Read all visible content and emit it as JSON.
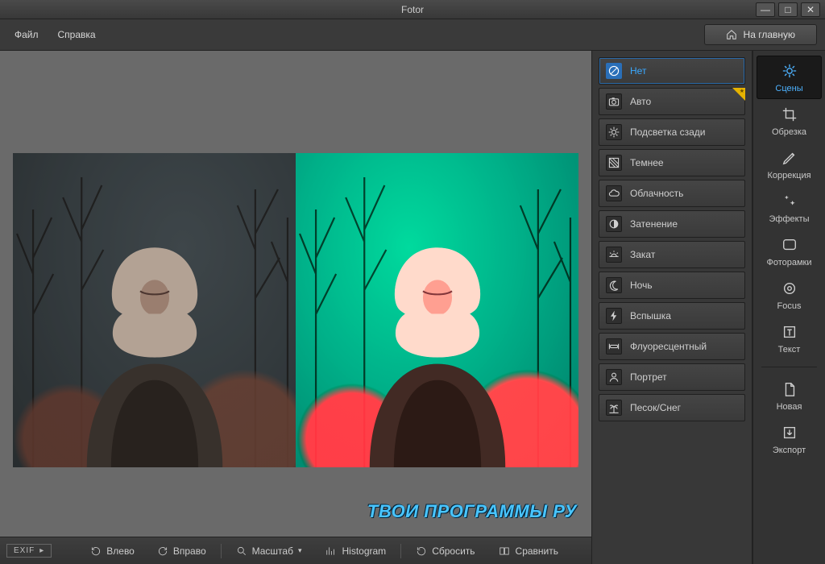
{
  "app": {
    "title": "Fotor"
  },
  "window_controls": {
    "min": "—",
    "max": "□",
    "close": "✕"
  },
  "menubar": {
    "file": "Файл",
    "help": "Справка"
  },
  "header": {
    "home": "На главную"
  },
  "presets": {
    "items": [
      {
        "id": "none",
        "label": "Нет",
        "icon": "prohibit",
        "active": true,
        "starred": false
      },
      {
        "id": "auto",
        "label": "Авто",
        "icon": "camera",
        "active": false,
        "starred": true
      },
      {
        "id": "backlit",
        "label": "Подсветка сзади",
        "icon": "sunback",
        "active": false,
        "starred": false
      },
      {
        "id": "darken",
        "label": "Темнее",
        "icon": "darken",
        "active": false,
        "starred": false
      },
      {
        "id": "cloudy",
        "label": "Облачность",
        "icon": "cloud",
        "active": false,
        "starred": false
      },
      {
        "id": "shade",
        "label": "Затенение",
        "icon": "shade",
        "active": false,
        "starred": false
      },
      {
        "id": "sunset",
        "label": "Закат",
        "icon": "sunset",
        "active": false,
        "starred": false
      },
      {
        "id": "night",
        "label": "Ночь",
        "icon": "moon",
        "active": false,
        "starred": false
      },
      {
        "id": "flash",
        "label": "Вспышка",
        "icon": "flash",
        "active": false,
        "starred": false
      },
      {
        "id": "fluorescent",
        "label": "Флуоресцентный",
        "icon": "fluor",
        "active": false,
        "starred": false
      },
      {
        "id": "portrait",
        "label": "Портрет",
        "icon": "portrait",
        "active": false,
        "starred": false
      },
      {
        "id": "sandsnow",
        "label": "Песок/Снег",
        "icon": "palm",
        "active": false,
        "starred": false
      }
    ]
  },
  "tools": {
    "items": [
      {
        "id": "scenes",
        "label": "Сцены",
        "icon": "sparkle",
        "active": true
      },
      {
        "id": "crop",
        "label": "Обрезка",
        "icon": "crop",
        "active": false
      },
      {
        "id": "adjust",
        "label": "Коррекция",
        "icon": "pencil",
        "active": false
      },
      {
        "id": "effects",
        "label": "Эффекты",
        "icon": "stars",
        "active": false
      },
      {
        "id": "frames",
        "label": "Фоторамки",
        "icon": "frame",
        "active": false
      },
      {
        "id": "focus",
        "label": "Focus",
        "icon": "target",
        "active": false
      },
      {
        "id": "text",
        "label": "Текст",
        "icon": "text",
        "active": false
      }
    ],
    "bottom": [
      {
        "id": "new",
        "label": "Новая",
        "icon": "page"
      },
      {
        "id": "export",
        "label": "Экспорт",
        "icon": "download"
      }
    ]
  },
  "bottombar": {
    "exif": "EXIF",
    "left": "Влево",
    "right": "Вправо",
    "zoom": "Масштаб",
    "histogram": "Histogram",
    "reset": "Сбросить",
    "compare": "Сравнить"
  },
  "watermark": "ТВОИ ПРОГРАММЫ РУ"
}
